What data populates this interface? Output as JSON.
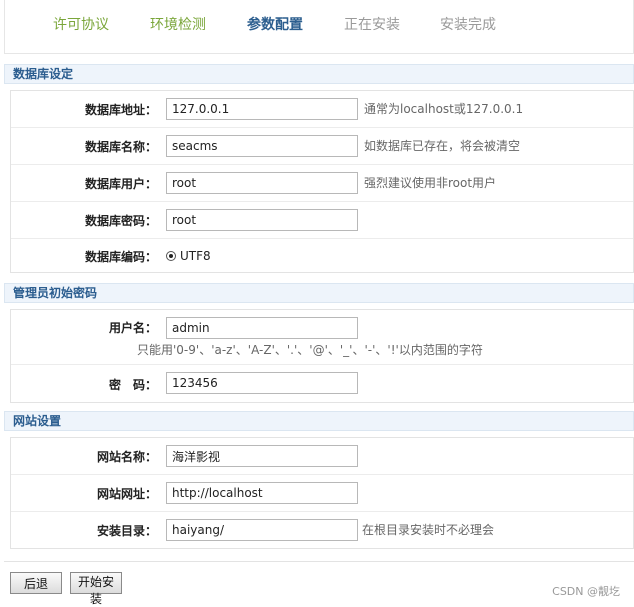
{
  "steps": [
    {
      "label": "许可协议",
      "state": "done"
    },
    {
      "label": "环境检测",
      "state": "done"
    },
    {
      "label": "参数配置",
      "state": "current"
    },
    {
      "label": "正在安装",
      "state": "todo"
    },
    {
      "label": "安装完成",
      "state": "todo"
    }
  ],
  "database": {
    "title": "数据库设定",
    "host": {
      "label": "数据库地址：",
      "value": "127.0.0.1",
      "hint": "通常为localhost或127.0.0.1"
    },
    "name": {
      "label": "数据库名称：",
      "value": "seacms",
      "hint": "如数据库已存在，将会被清空"
    },
    "user": {
      "label": "数据库用户：",
      "value": "root",
      "hint": "强烈建议使用非root用户"
    },
    "password": {
      "label": "数据库密码：",
      "value": "root"
    },
    "charset": {
      "label": "数据库编码：",
      "option": "UTF8"
    }
  },
  "admin": {
    "title": "管理员初始密码",
    "username": {
      "label": "用户名：",
      "value": "admin",
      "hint": "只能用'0-9'、'a-z'、'A-Z'、'.'、'@'、'_'、'-'、'!'以内范围的字符"
    },
    "password": {
      "label": "密　码：",
      "value": "123456"
    }
  },
  "site": {
    "title": "网站设置",
    "name": {
      "label": "网站名称：",
      "value": "海洋影视"
    },
    "url": {
      "label": "网站网址：",
      "value": "http://localhost"
    },
    "dir": {
      "label": "安装目录：",
      "value": "haiyang/",
      "hint": "在根目录安装时不必理会"
    }
  },
  "buttons": {
    "back": "后退",
    "install": "开始安装"
  },
  "watermark": "CSDN @靓圪"
}
